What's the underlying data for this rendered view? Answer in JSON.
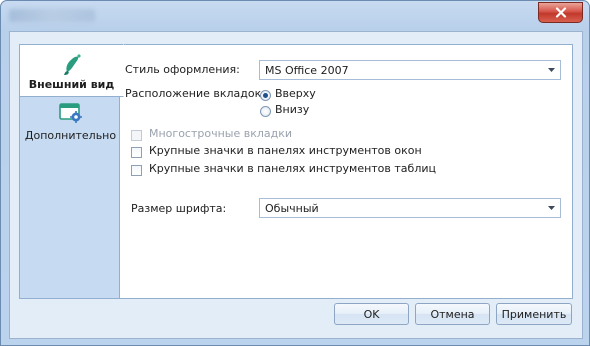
{
  "nav": {
    "items": [
      {
        "label": "Внешний вид",
        "icon": "paint-brush-icon",
        "active": true
      },
      {
        "label": "Дополнительно",
        "icon": "window-settings-icon",
        "active": false
      }
    ]
  },
  "appearance": {
    "style_label": "Стиль оформления:",
    "style_value": "MS Office 2007",
    "tabs_position_label": "Расположение вкладок:",
    "tabs_position_options": [
      "Вверху",
      "Внизу"
    ],
    "tabs_position_selected": "Вверху",
    "multiline_tabs_label": "Многострочные вкладки",
    "large_icons_window_toolbars_label": "Крупные значки в панелях инструментов окон",
    "large_icons_table_toolbars_label": "Крупные значки в панелях инструментов таблиц",
    "font_size_label": "Размер шрифта:",
    "font_size_value": "Обычный"
  },
  "buttons": {
    "ok": "OK",
    "cancel": "Отмена",
    "apply": "Применить"
  },
  "colors": {
    "accent": "#1c4f8c",
    "close_button": "#c0392b",
    "nav_icon_teal": "#2a9d7f",
    "nav_icon_blue": "#3a78c2"
  }
}
